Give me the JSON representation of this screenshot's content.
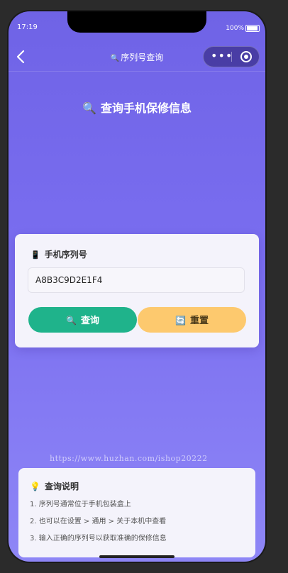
{
  "status_bar": {
    "time": "17:19",
    "battery": "100%"
  },
  "nav": {
    "title_icon": "🔍",
    "title": "序列号查询"
  },
  "heading": {
    "icon": "🔍",
    "text": "查询手机保修信息"
  },
  "form": {
    "label_icon": "📱",
    "label": "手机序列号",
    "serial_value": "A8B3C9D2E1F4",
    "query_icon": "🔍",
    "query_label": "查询",
    "reset_icon": "🔄",
    "reset_label": "重置",
    "query_color": "#1fb38b",
    "reset_color": "#fdc96e"
  },
  "watermark": "https://www.huzhan.com/ishop20222",
  "help": {
    "icon": "💡",
    "title": "查询说明",
    "items": [
      "1. 序列号通常位于手机包装盒上",
      "2. 也可以在设置 > 通用 > 关于本机中查看",
      "3. 输入正确的序列号以获取准确的保修信息"
    ]
  }
}
